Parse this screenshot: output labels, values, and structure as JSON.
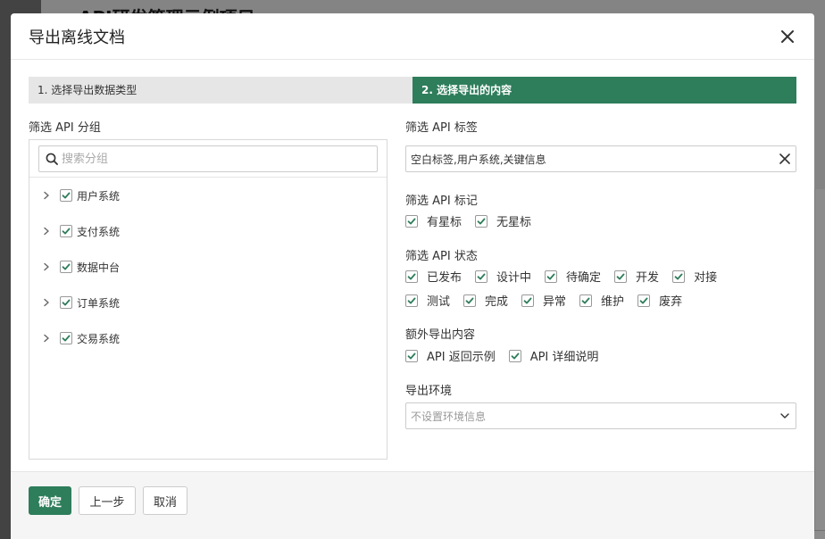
{
  "modal": {
    "title": "导出离线文档"
  },
  "steps": [
    {
      "label": "1. 选择导出数据类型"
    },
    {
      "label": "2. 选择导出的内容"
    }
  ],
  "groups": {
    "label": "筛选 API 分组",
    "search_placeholder": "搜索分组",
    "items": [
      {
        "label": "用户系统",
        "checked": true
      },
      {
        "label": "支付系统",
        "checked": true
      },
      {
        "label": "数据中台",
        "checked": true
      },
      {
        "label": "订单系统",
        "checked": true
      },
      {
        "label": "交易系统",
        "checked": true
      }
    ]
  },
  "tags": {
    "label": "筛选 API 标签",
    "value": "空白标签,用户系统,关键信息"
  },
  "marks": {
    "label": "筛选 API 标记",
    "options": [
      {
        "label": "有星标",
        "checked": true
      },
      {
        "label": "无星标",
        "checked": true
      }
    ]
  },
  "status": {
    "label": "筛选 API 状态",
    "options": [
      {
        "label": "已发布",
        "checked": true
      },
      {
        "label": "设计中",
        "checked": true
      },
      {
        "label": "待确定",
        "checked": true
      },
      {
        "label": "开发",
        "checked": true
      },
      {
        "label": "对接",
        "checked": true
      },
      {
        "label": "测试",
        "checked": true
      },
      {
        "label": "完成",
        "checked": true
      },
      {
        "label": "异常",
        "checked": true
      },
      {
        "label": "维护",
        "checked": true
      },
      {
        "label": "废弃",
        "checked": true
      }
    ]
  },
  "extra": {
    "label": "额外导出内容",
    "options": [
      {
        "label": "API 返回示例",
        "checked": true
      },
      {
        "label": "API 详细说明",
        "checked": true
      }
    ]
  },
  "env": {
    "label": "导出环境",
    "placeholder": "不设置环境信息"
  },
  "footer": {
    "confirm_label": "确定",
    "prev_label": "上一步",
    "cancel_label": "取消"
  },
  "background": {
    "title_fragment": "API研发管理示例项目"
  },
  "colors": {
    "accent": "#2e7d5b"
  }
}
